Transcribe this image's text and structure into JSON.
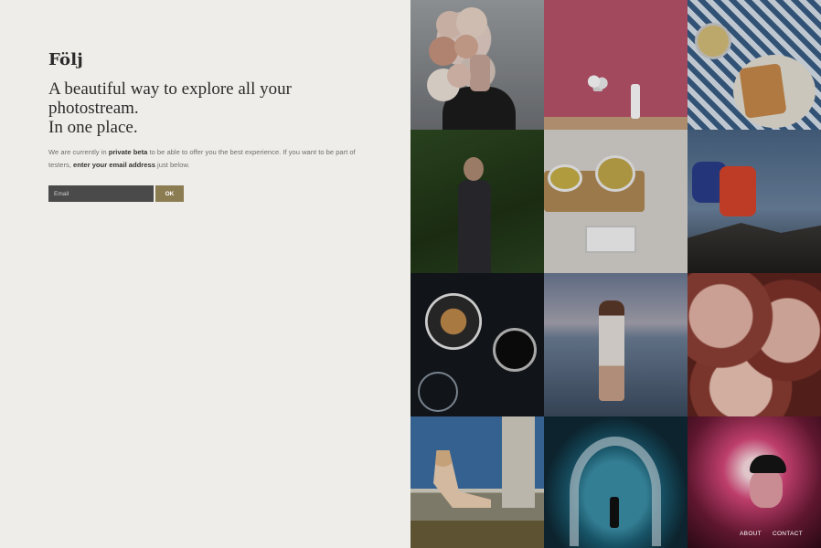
{
  "brand": "Följ",
  "headline": {
    "line1": "A beautiful way to explore all your",
    "line2": "photostream.",
    "line3": "In one place."
  },
  "blurb": {
    "part1": "We are currently in ",
    "bold1": "private beta",
    "part2": " to be able to offer you the best experience. If you want to be part of testers, ",
    "bold2": "enter your email address",
    "part3": " just below."
  },
  "signup": {
    "email_placeholder": "Email",
    "submit_label": "OK"
  },
  "photos": [
    {
      "icon": "flower-portrait-photo"
    },
    {
      "icon": "balloons-walker-photo"
    },
    {
      "icon": "breakfast-table-photo"
    },
    {
      "icon": "man-on-grass-photo"
    },
    {
      "icon": "tea-tray-photo"
    },
    {
      "icon": "hiker-photo"
    },
    {
      "icon": "coffee-bowl-photo"
    },
    {
      "icon": "beach-girl-photo"
    },
    {
      "icon": "protea-flowers-photo"
    },
    {
      "icon": "woman-chair-photo"
    },
    {
      "icon": "ice-cave-photo"
    },
    {
      "icon": "man-cap-photo"
    }
  ],
  "footer": {
    "about": "ABOUT",
    "contact": "CONTACT"
  },
  "colors": {
    "background": "#eeede9",
    "input": "#4a4a4a",
    "button": "#8c7c52"
  }
}
